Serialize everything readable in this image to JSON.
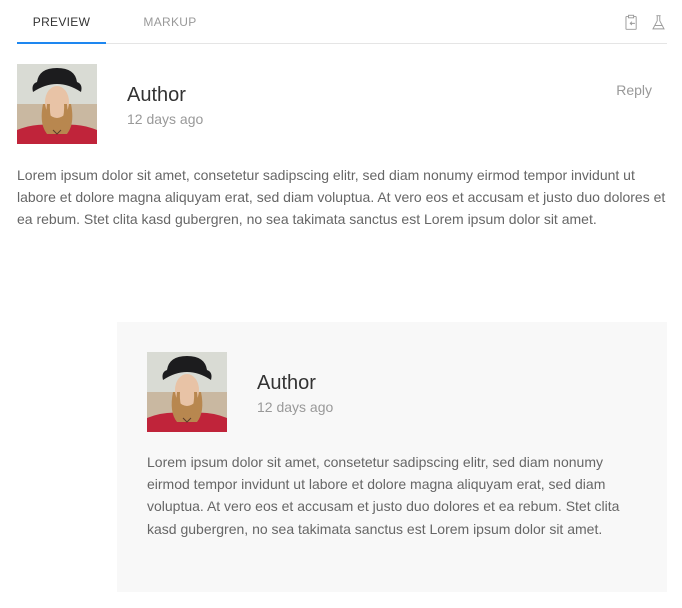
{
  "tabs": [
    {
      "label": "Preview",
      "active": true
    },
    {
      "label": "Markup",
      "active": false
    }
  ],
  "toolbar_icons": [
    "copy-to-clipboard-icon",
    "flask-icon"
  ],
  "accent_color": "#1e87f0",
  "comments": [
    {
      "author": "Author",
      "meta": "12 days ago",
      "reply": "Reply",
      "body": "Lorem ipsum dolor sit amet, consetetur sadipscing elitr, sed diam nonumy eirmod tempor invidunt ut labore et dolore magna aliquyam erat, sed diam voluptua. At vero eos et accusam et justo duo dolores et ea rebum. Stet clita kasd gubergren, no sea takimata sanctus est Lorem ipsum dolor sit amet."
    },
    {
      "author": "Author",
      "meta": "12 days ago",
      "body": "Lorem ipsum dolor sit amet, consetetur sadipscing elitr, sed diam nonumy eirmod tempor invidunt ut labore et dolore magna aliquyam erat, sed diam voluptua. At vero eos et accusam et justo duo dolores et ea rebum. Stet clita kasd gubergren, no sea takimata sanctus est Lorem ipsum dolor sit amet."
    }
  ]
}
